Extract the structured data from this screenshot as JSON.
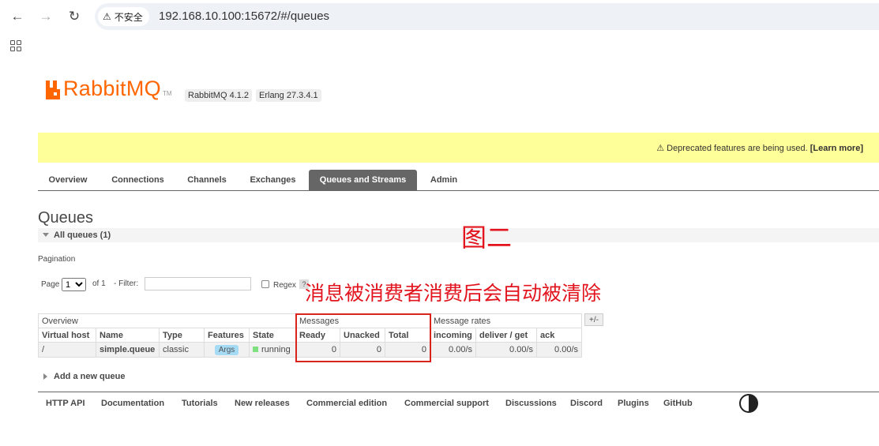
{
  "browser": {
    "insecure_label": "不安全",
    "url": "192.168.10.100:15672/#/queues"
  },
  "logo": {
    "text": "RabbitMQ",
    "tm": "TM"
  },
  "versions": {
    "rabbitmq": "RabbitMQ 4.1.2",
    "erlang": "Erlang 27.3.4.1"
  },
  "banner": {
    "text": "⚠ Deprecated features are being used. ",
    "link": "[Learn more]"
  },
  "tabs": [
    {
      "label": "Overview"
    },
    {
      "label": "Connections"
    },
    {
      "label": "Channels"
    },
    {
      "label": "Exchanges"
    },
    {
      "label": "Queues and Streams"
    },
    {
      "label": "Admin"
    }
  ],
  "page_title": "Queues",
  "all_queues": "All queues (1)",
  "pagination": {
    "label": "Pagination",
    "page_label": "Page",
    "page_value": "1",
    "of_label": "of 1",
    "filter_label": "- Filter:",
    "regex_label": "Regex",
    "help": "?"
  },
  "annotation": {
    "title": "图二",
    "message": "消息被消费者消费后会自动被清除"
  },
  "table": {
    "groups": {
      "overview": "Overview",
      "messages": "Messages",
      "rates": "Message rates"
    },
    "plus_minus": "+/-",
    "headers": {
      "vhost": "Virtual host",
      "name": "Name",
      "type": "Type",
      "features": "Features",
      "state": "State",
      "ready": "Ready",
      "unacked": "Unacked",
      "total": "Total",
      "incoming": "incoming",
      "deliver": "deliver / get",
      "ack": "ack"
    },
    "row": {
      "vhost": "/",
      "name": "simple.queue",
      "type": "classic",
      "features": "Args",
      "state": "running",
      "ready": "0",
      "unacked": "0",
      "total": "0",
      "incoming": "0.00/s",
      "deliver": "0.00/s",
      "ack": "0.00/s"
    }
  },
  "add_queue": "Add a new queue",
  "footer": [
    {
      "label": "HTTP API"
    },
    {
      "label": "Documentation"
    },
    {
      "label": "Tutorials"
    },
    {
      "label": "New releases"
    },
    {
      "label": "Commercial edition"
    },
    {
      "label": "Commercial support"
    },
    {
      "label": "Discussions"
    },
    {
      "label": "Discord"
    },
    {
      "label": "Plugins"
    },
    {
      "label": "GitHub"
    }
  ],
  "colors": {
    "brand": "#ff6600",
    "banner": "#ffff99",
    "annotation": "#e2141e",
    "active_tab": "#666666"
  }
}
